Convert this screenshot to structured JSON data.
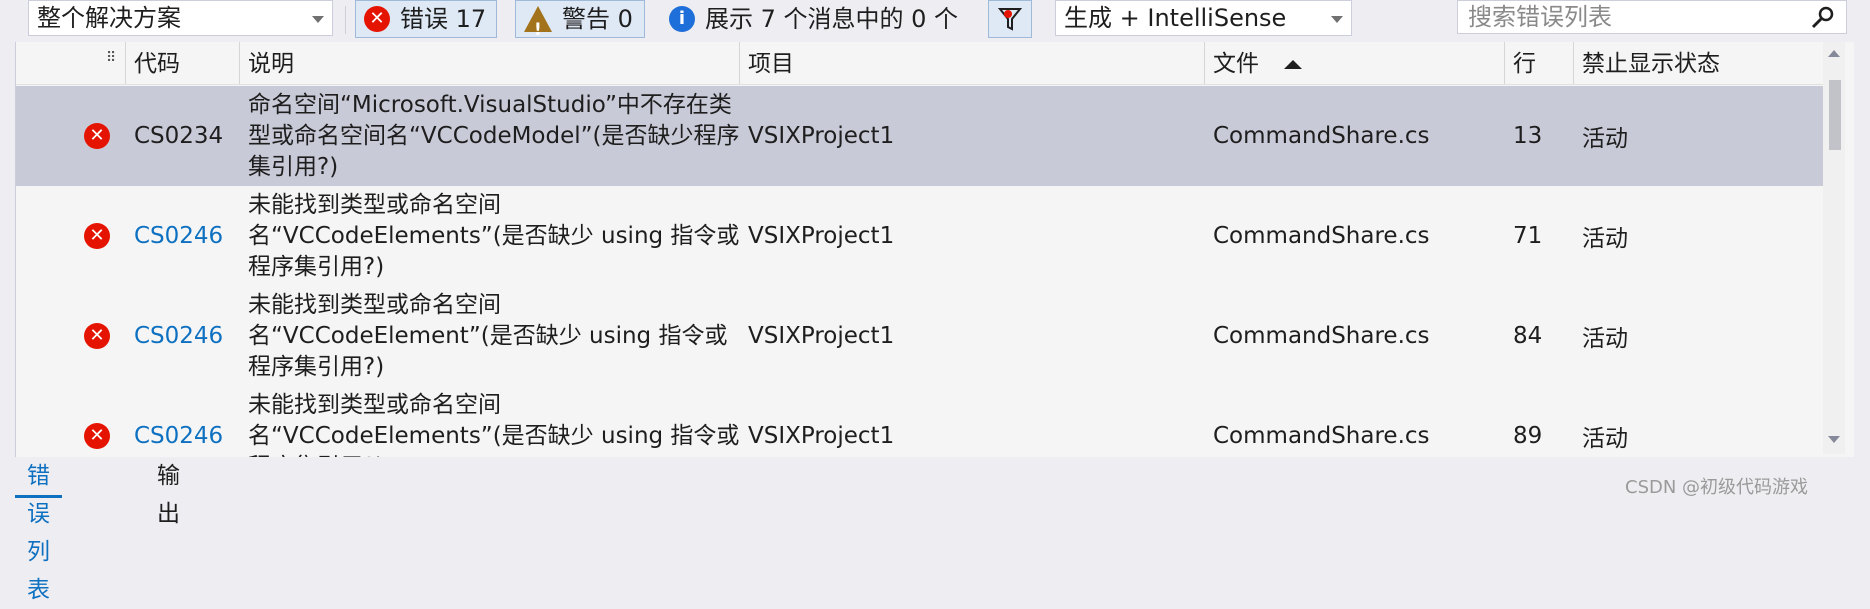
{
  "toolbar": {
    "scope_value": "整个解决方案",
    "errors_label": "错误 17",
    "warnings_label": "警告 0",
    "messages_label": "展示 7 个消息中的 0 个",
    "build_value": "生成 + IntelliSense",
    "search_placeholder": "搜索错误列表"
  },
  "columns": {
    "code": "代码",
    "desc": "说明",
    "project": "项目",
    "file": "文件",
    "line": "行",
    "suppression": "禁止显示状态"
  },
  "rows": [
    {
      "code": "CS0234",
      "desc": "命名空间“Microsoft.VisualStudio”中不存在类型或命名空间名“VCCodeModel”(是否缺少程序集引用?)",
      "project": "VSIXProject1",
      "file": "CommandShare.cs",
      "line": "13",
      "state": "活动"
    },
    {
      "code": "CS0246",
      "desc": "未能找到类型或命名空间名“VCCodeElements”(是否缺少 using 指令或程序集引用?)",
      "project": "VSIXProject1",
      "file": "CommandShare.cs",
      "line": "71",
      "state": "活动"
    },
    {
      "code": "CS0246",
      "desc": "未能找到类型或命名空间名“VCCodeElement”(是否缺少 using 指令或程序集引用?)",
      "project": "VSIXProject1",
      "file": "CommandShare.cs",
      "line": "84",
      "state": "活动"
    },
    {
      "code": "CS0246",
      "desc": "未能找到类型或命名空间名“VCCodeElements”(是否缺少 using 指令或程序集引用?)",
      "project": "VSIXProject1",
      "file": "CommandShare.cs",
      "line": "89",
      "state": "活动"
    }
  ],
  "tabs": {
    "errors": "错误列表",
    "output": "输出"
  },
  "watermark": "CSDN @初级代码游戏",
  "colors": {
    "error": "#e51400",
    "link": "#0e70c0",
    "selected_row": "#c9cad8"
  }
}
